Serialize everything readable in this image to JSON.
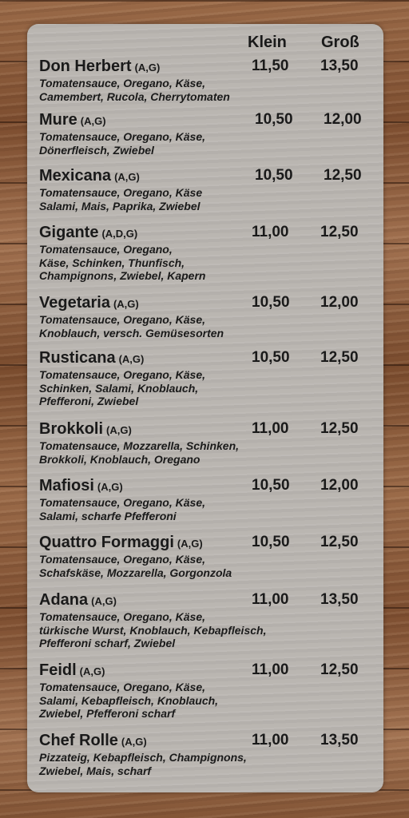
{
  "header": {
    "klein": "Klein",
    "gross": "Groß"
  },
  "items": [
    {
      "name": "Don Herbert",
      "allergens": "(A,G)",
      "klein": "11,50",
      "gross": "13,50",
      "desc": "Tomatensauce, Oregano, Käse,\nCamembert, Rucola, Cherrytomaten"
    },
    {
      "name": "Mure",
      "allergens": "(A,G)",
      "klein": "10,50",
      "gross": "12,00",
      "desc": "Tomatensauce, Oregano, Käse,\nDönerfleisch, Zwiebel"
    },
    {
      "name": "Mexicana",
      "allergens": "(A,G)",
      "klein": "10,50",
      "gross": "12,50",
      "desc": "Tomatensauce, Oregano, Käse\nSalami, Mais, Paprika, Zwiebel"
    },
    {
      "name": "Gigante",
      "allergens": "(A,D,G)",
      "klein": "11,00",
      "gross": "12,50",
      "desc": "Tomatensauce, Oregano,\nKäse, Schinken, Thunfisch,\nChampignons, Zwiebel, Kapern"
    },
    {
      "name": "Vegetaria",
      "allergens": "(A,G)",
      "klein": "10,50",
      "gross": "12,00",
      "desc": "Tomatensauce, Oregano, Käse,\nKnoblauch, versch. Gemüsesorten"
    },
    {
      "name": "Rusticana",
      "allergens": "(A,G)",
      "klein": "10,50",
      "gross": "12,50",
      "desc": "Tomatensauce, Oregano, Käse,\nSchinken, Salami, Knoblauch,\nPfefferoni, Zwiebel"
    },
    {
      "name": "Brokkoli",
      "allergens": "(A,G)",
      "klein": "11,00",
      "gross": "12,50",
      "desc": "Tomatensauce, Mozzarella, Schinken,\nBrokkoli, Knoblauch, Oregano"
    },
    {
      "name": "Mafiosi",
      "allergens": "(A,G)",
      "klein": "10,50",
      "gross": "12,00",
      "desc": "Tomatensauce, Oregano, Käse,\nSalami, scharfe Pfefferoni"
    },
    {
      "name": "Quattro Formaggi",
      "allergens": "(A,G)",
      "klein": "10,50",
      "gross": "12,50",
      "desc": "Tomatensauce, Oregano, Käse,\nSchafskäse, Mozzarella, Gorgonzola"
    },
    {
      "name": "Adana",
      "allergens": "(A,G)",
      "klein": "11,00",
      "gross": "13,50",
      "desc": "Tomatensauce, Oregano, Käse,\ntürkische Wurst, Knoblauch, Kebapfleisch,\nPfefferoni scharf, Zwiebel"
    },
    {
      "name": "Feidl",
      "allergens": "(A,G)",
      "klein": "11,00",
      "gross": "12,50",
      "desc": "Tomatensauce, Oregano, Käse,\nSalami, Kebapfleisch, Knoblauch,\nZwiebel, Pfefferoni scharf"
    },
    {
      "name": "Chef Rolle",
      "allergens": "(A,G)",
      "klein": "11,00",
      "gross": "13,50",
      "desc": "Pizzateig, Kebapfleisch, Champignons,\nZwiebel, Mais, scharf"
    }
  ]
}
